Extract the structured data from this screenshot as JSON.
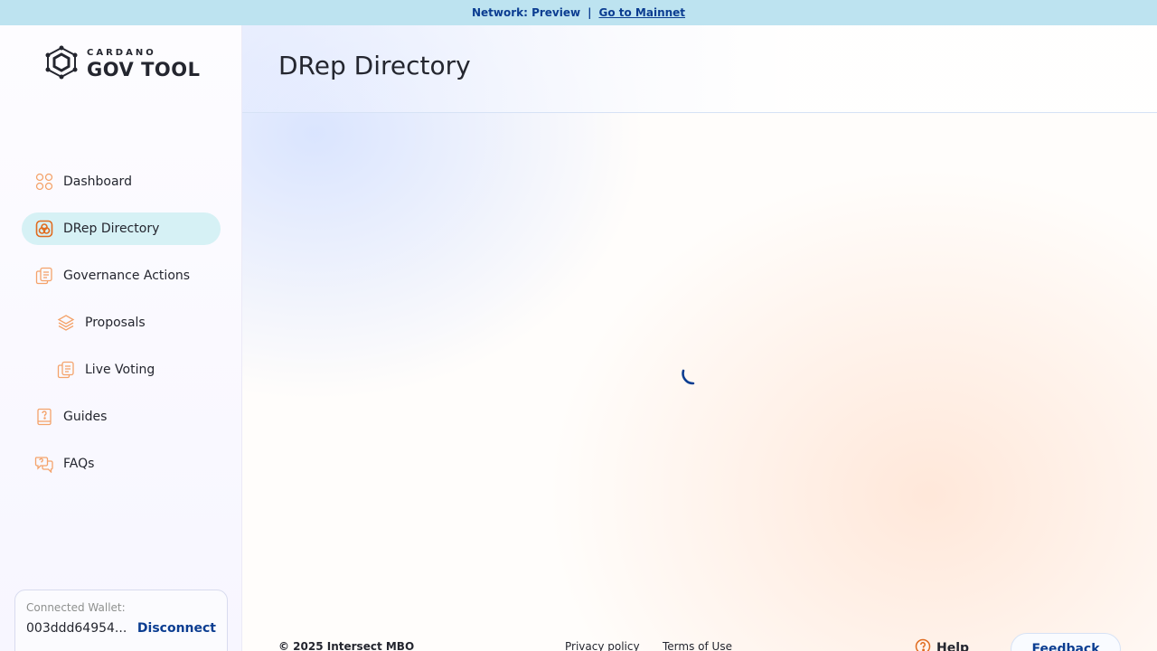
{
  "banner": {
    "network_text": "Network: Preview",
    "separator": "|",
    "mainnet_link": "Go to Mainnet"
  },
  "logo": {
    "small": "CARDANO",
    "big": "GOV TOOL"
  },
  "sidebar": {
    "items": [
      {
        "label": "Dashboard",
        "icon": "dashboard-icon"
      },
      {
        "label": "DRep Directory",
        "icon": "drep-icon",
        "active": true
      },
      {
        "label": "Governance Actions",
        "icon": "documents-icon"
      },
      {
        "label": "Proposals",
        "icon": "layers-icon"
      },
      {
        "label": "Live Voting",
        "icon": "documents-icon"
      },
      {
        "label": "Guides",
        "icon": "book-question-icon"
      },
      {
        "label": "FAQs",
        "icon": "chat-question-icon"
      }
    ]
  },
  "wallet": {
    "label": "Connected Wallet:",
    "address": "003ddd64954...",
    "disconnect_label": "Disconnect"
  },
  "header": {
    "title": "DRep Directory"
  },
  "footer": {
    "copyright": "© 2025 Intersect MBO",
    "privacy": "Privacy policy",
    "terms": "Terms of Use",
    "help": "Help",
    "feedback": "Feedback"
  },
  "colors": {
    "accent": "#0b3d91",
    "icon_orange": "#f4a36b",
    "active_bg": "#d6f1f5",
    "banner_bg": "#bde3f0"
  }
}
